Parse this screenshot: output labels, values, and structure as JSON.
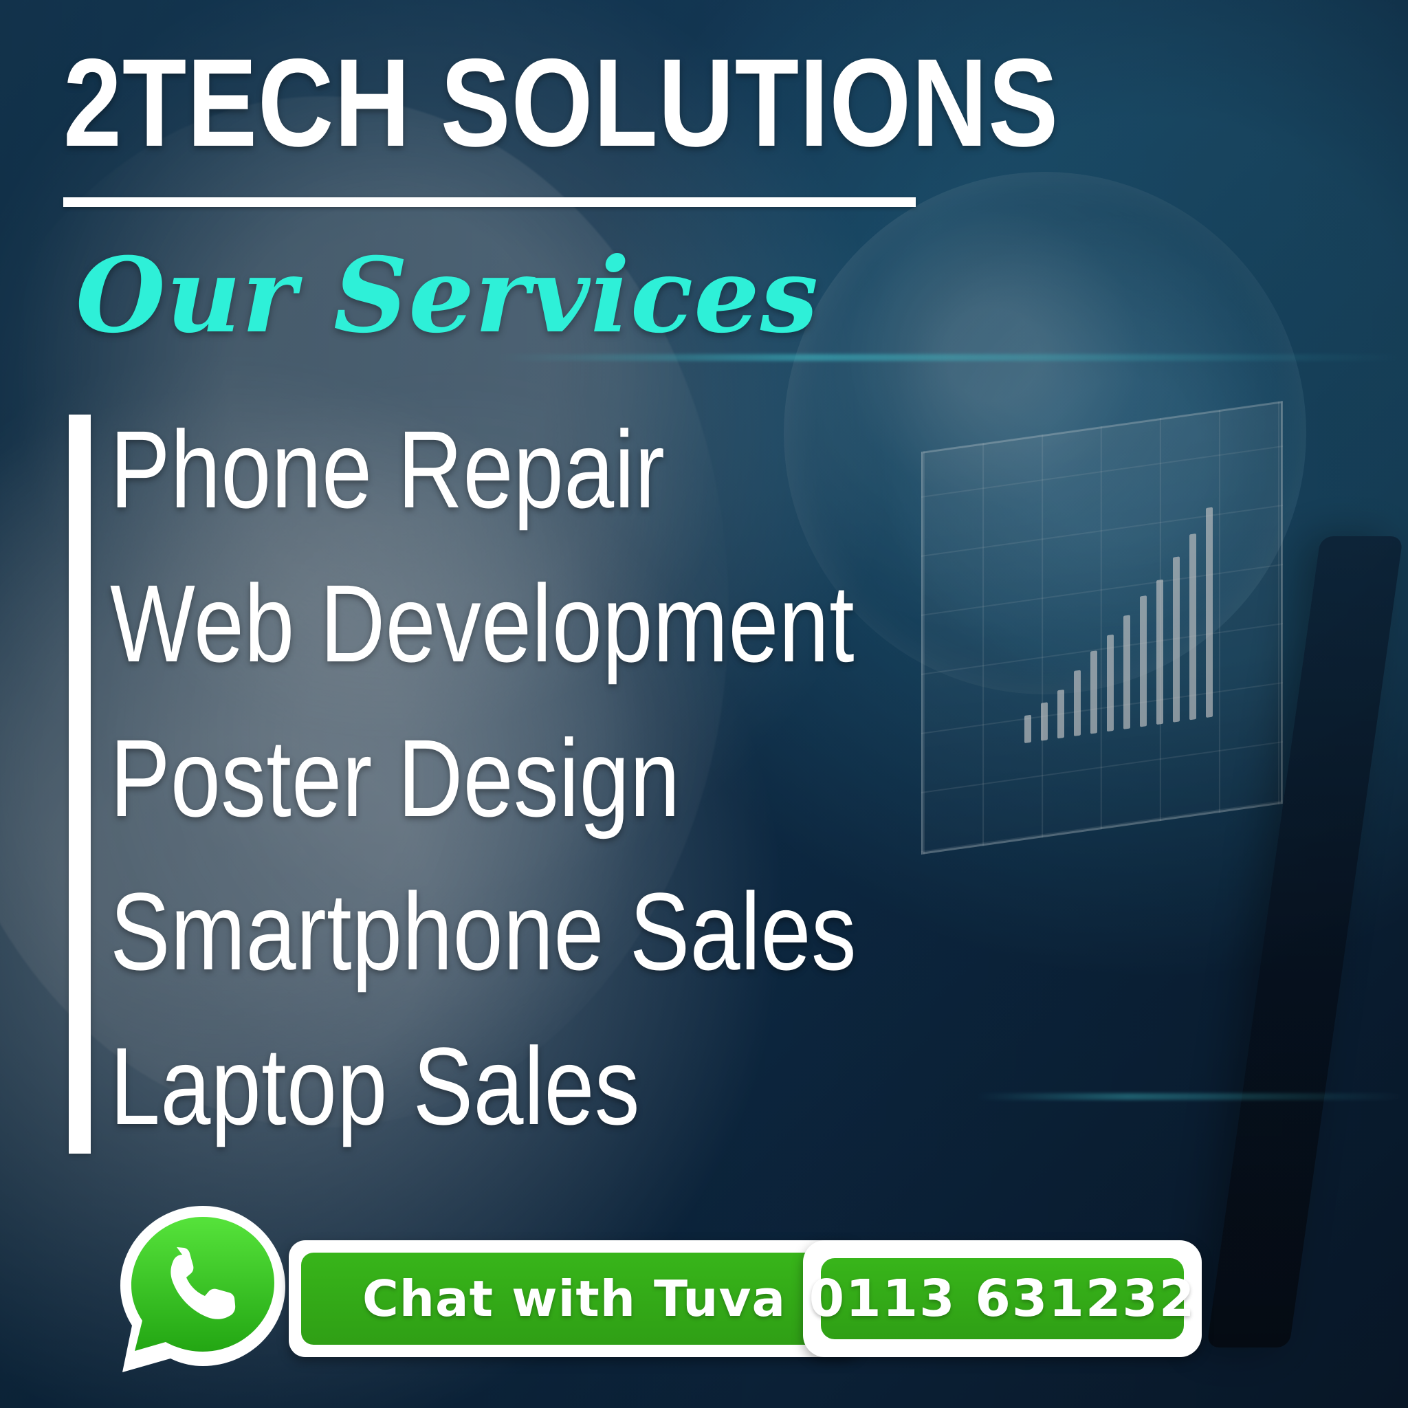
{
  "header": {
    "title": "2TECH SOLUTIONS"
  },
  "services": {
    "heading": "Our Services",
    "items": [
      "Phone Repair",
      "Web Development",
      "Poster Design",
      "Smartphone Sales",
      " Laptop Sales"
    ]
  },
  "contact": {
    "chat_label": "Chat with Tuva",
    "phone_number": "0113 631232"
  },
  "colors": {
    "accent": "#2ef0d8",
    "whatsapp_green": "#2f9f15",
    "white": "#ffffff"
  },
  "icons": {
    "whatsapp": "whatsapp-icon"
  }
}
